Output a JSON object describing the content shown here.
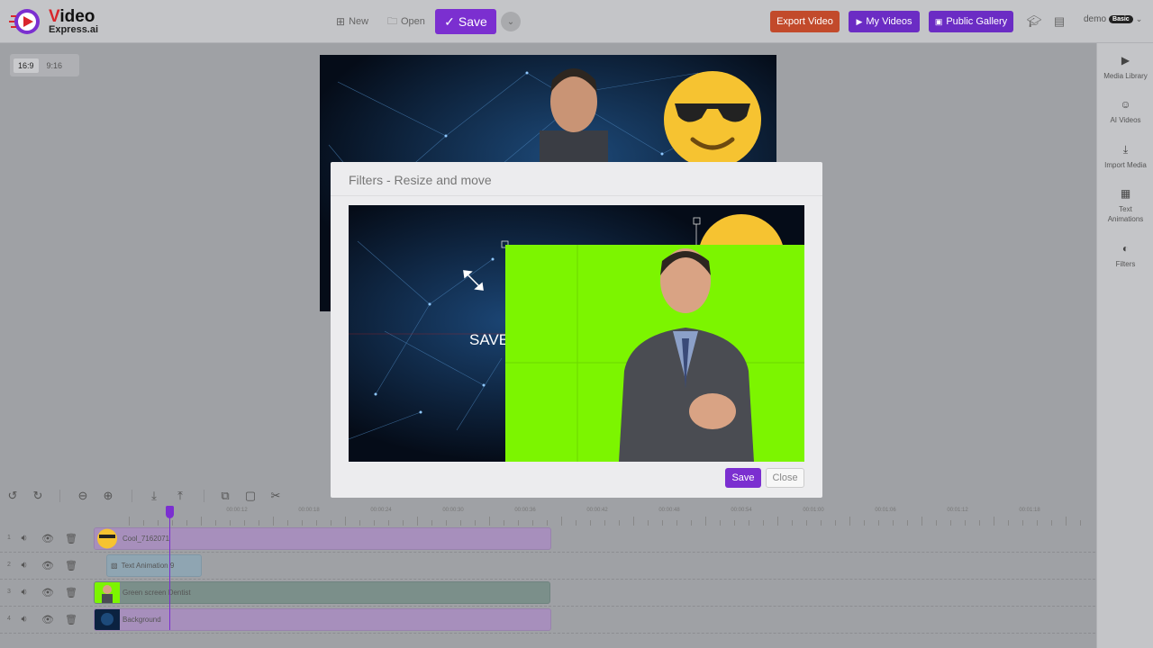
{
  "app": {
    "logo_line1_v": "V",
    "logo_line1_rest": "ideo",
    "logo_line2": "Express.ai"
  },
  "toolbar": {
    "new_label": "New",
    "open_label": "Open",
    "save_label": "Save",
    "export_label": "Export Video",
    "my_videos_label": "My Videos",
    "public_gallery_label": "Public Gallery",
    "user_name": "demo",
    "plan_badge": "Basic"
  },
  "aspect": {
    "options": [
      "16:9",
      "9:16"
    ],
    "selected": "16:9"
  },
  "sidebar": {
    "items": [
      {
        "label": "Media Library",
        "icon": "media-library-icon"
      },
      {
        "label": "AI Videos",
        "icon": "robot-icon"
      },
      {
        "label": "Import Media",
        "icon": "import-icon"
      },
      {
        "label": "Text Animations",
        "icon": "film-icon"
      },
      {
        "label": "Filters",
        "icon": "filters-icon"
      }
    ]
  },
  "modal": {
    "title": "Filters - Resize and move",
    "overlay_text": "SAVE",
    "save_label": "Save",
    "close_label": "Close"
  },
  "timeline": {
    "ruler_labels": [
      "00:00:12",
      "00:00:18",
      "00:00:24",
      "00:00:30",
      "00:00:36",
      "00:00:42",
      "00:00:48",
      "00:00:54",
      "00:01:00",
      "00:01:06",
      "00:01:12",
      "00:01:18"
    ],
    "tracks": [
      {
        "number": "1",
        "clip_label": "Cool_7162071"
      },
      {
        "number": "2",
        "clip_label": "Text Animation 9"
      },
      {
        "number": "3",
        "clip_label": "Green screen Dentist"
      },
      {
        "number": "4",
        "clip_label": "Background"
      }
    ]
  },
  "colors": {
    "brand_purple": "#7b2fd0",
    "export_orange": "#c24a2b",
    "green_screen": "#7cf500"
  }
}
